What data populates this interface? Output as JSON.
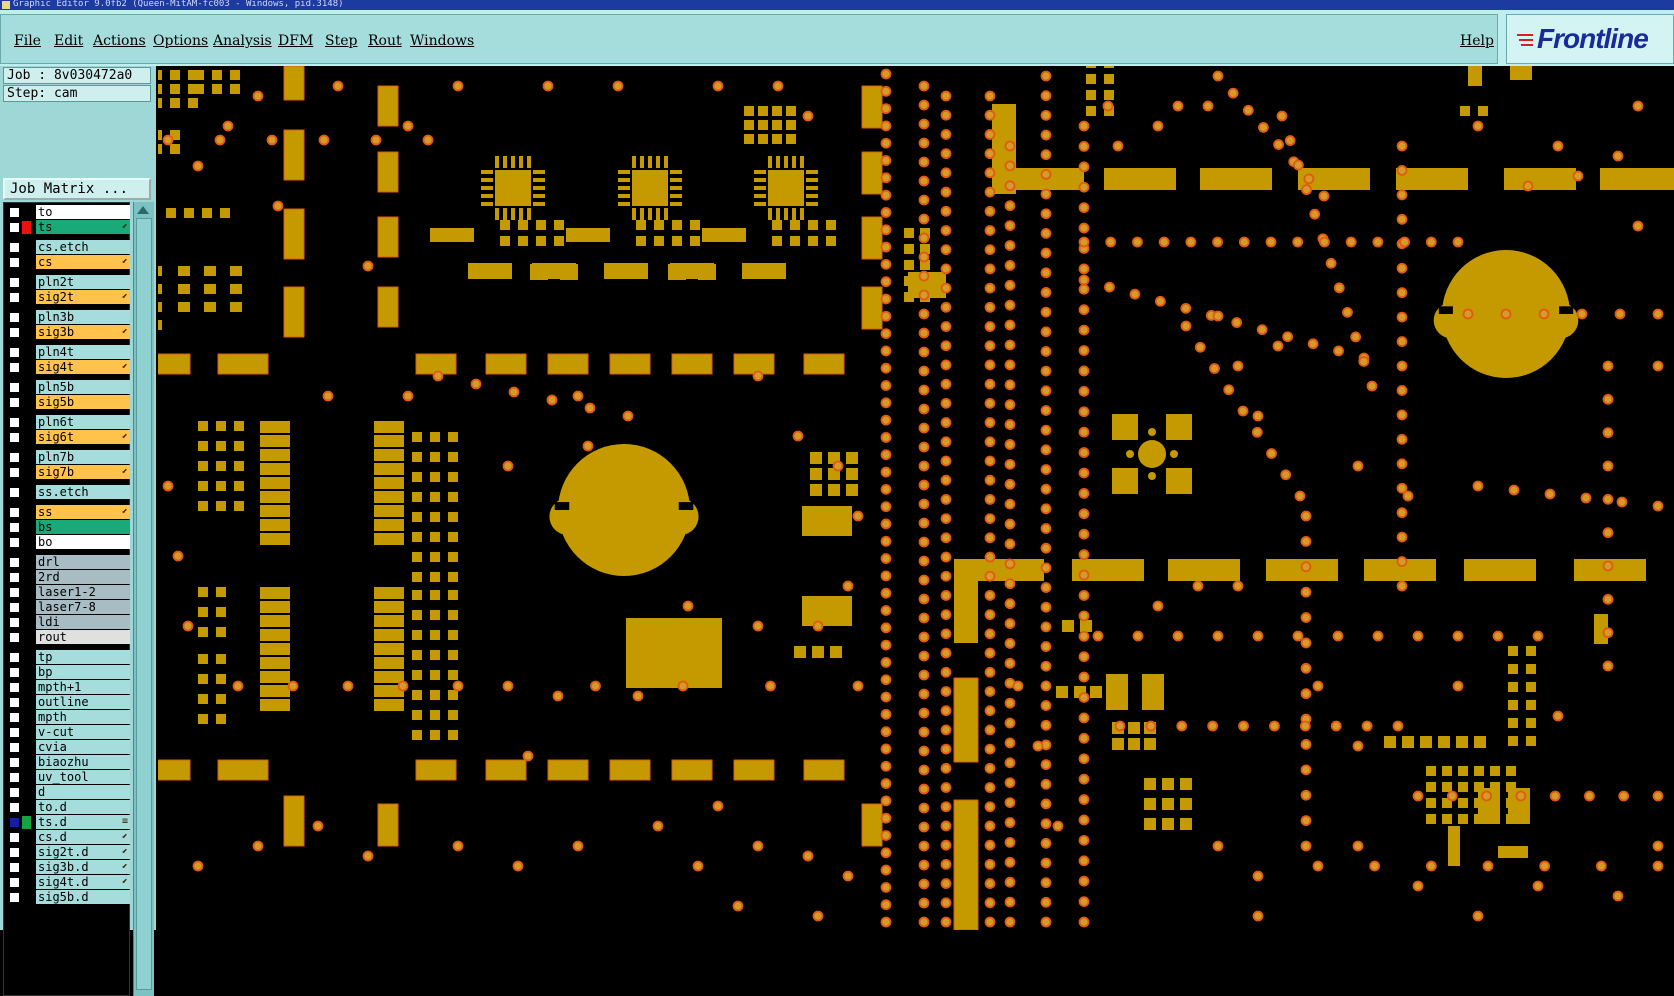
{
  "window": {
    "title": "Graphic Editor 9.0fb2 (Queen-MitAM-fc003 - Windows, pid.3148)"
  },
  "menu": {
    "items": [
      "File",
      "Edit",
      "Actions",
      "Options",
      "Analysis",
      "DFM",
      "Step",
      "Rout",
      "Windows"
    ],
    "help": "Help"
  },
  "logo": {
    "text": "Frontline"
  },
  "job": {
    "job_line": "Job : 8v030472a0",
    "step_line": "Step: cam",
    "matrix_button": "Job Matrix ..."
  },
  "layers": [
    {
      "name": "to",
      "color": "white",
      "flag": "",
      "mark": ""
    },
    {
      "name": "ts",
      "color": "green",
      "flag": "red",
      "mark": "⬋"
    },
    {
      "name": "cs.etch",
      "color": "teal",
      "flag": "",
      "mark": ""
    },
    {
      "name": "cs",
      "color": "orange",
      "flag": "",
      "mark": "⬋"
    },
    {
      "name": "pln2t",
      "color": "teal",
      "flag": "",
      "mark": ""
    },
    {
      "name": "sig2t",
      "color": "orange",
      "flag": "",
      "mark": "⬋"
    },
    {
      "name": "pln3b",
      "color": "teal",
      "flag": "",
      "mark": ""
    },
    {
      "name": "sig3b",
      "color": "orange",
      "flag": "",
      "mark": "⬋"
    },
    {
      "name": "pln4t",
      "color": "teal",
      "flag": "",
      "mark": ""
    },
    {
      "name": "sig4t",
      "color": "orange",
      "flag": "",
      "mark": "⬋"
    },
    {
      "name": "pln5b",
      "color": "teal",
      "flag": "",
      "mark": ""
    },
    {
      "name": "sig5b",
      "color": "orange",
      "flag": "",
      "mark": ""
    },
    {
      "name": "pln6t",
      "color": "teal",
      "flag": "",
      "mark": ""
    },
    {
      "name": "sig6t",
      "color": "orange",
      "flag": "",
      "mark": "⬋"
    },
    {
      "name": "pln7b",
      "color": "teal",
      "flag": "",
      "mark": ""
    },
    {
      "name": "sig7b",
      "color": "orange",
      "flag": "",
      "mark": "⬋"
    },
    {
      "name": "ss.etch",
      "color": "teal",
      "flag": "",
      "mark": ""
    },
    {
      "name": "ss",
      "color": "orange",
      "flag": "",
      "mark": "⬋"
    },
    {
      "name": "bs",
      "color": "green",
      "flag": "",
      "mark": ""
    },
    {
      "name": "bo",
      "color": "white",
      "flag": "",
      "mark": ""
    },
    {
      "name": "drl",
      "color": "gray",
      "flag": "",
      "mark": ""
    },
    {
      "name": "2rd",
      "color": "gray",
      "flag": "",
      "mark": ""
    },
    {
      "name": "laser1-2",
      "color": "gray",
      "flag": "",
      "mark": ""
    },
    {
      "name": "laser7-8",
      "color": "gray",
      "flag": "",
      "mark": ""
    },
    {
      "name": "ldi",
      "color": "gray",
      "flag": "",
      "mark": ""
    },
    {
      "name": "rout",
      "color": "lightgray",
      "flag": "",
      "mark": ""
    },
    {
      "name": "tp",
      "color": "teal",
      "flag": "",
      "mark": ""
    },
    {
      "name": "bp",
      "color": "teal",
      "flag": "",
      "mark": ""
    },
    {
      "name": "mpth+1",
      "color": "teal",
      "flag": "",
      "mark": ""
    },
    {
      "name": "outline",
      "color": "teal",
      "flag": "",
      "mark": ""
    },
    {
      "name": "mpth",
      "color": "teal",
      "flag": "",
      "mark": ""
    },
    {
      "name": "v-cut",
      "color": "teal",
      "flag": "",
      "mark": ""
    },
    {
      "name": "cvia",
      "color": "teal",
      "flag": "",
      "mark": ""
    },
    {
      "name": "biaozhu",
      "color": "teal",
      "flag": "",
      "mark": ""
    },
    {
      "name": "uv_tool",
      "color": "teal",
      "flag": "",
      "mark": ""
    },
    {
      "name": "d",
      "color": "teal",
      "flag": "",
      "mark": ""
    },
    {
      "name": "to.d",
      "color": "teal",
      "flag": "",
      "mark": ""
    },
    {
      "name": "ts.d",
      "color": "teal",
      "flag": "green",
      "mark": "≡",
      "checked": true
    },
    {
      "name": "cs.d",
      "color": "teal",
      "flag": "",
      "mark": "⬋"
    },
    {
      "name": "sig2t.d",
      "color": "teal",
      "flag": "",
      "mark": "⬋"
    },
    {
      "name": "sig3b.d",
      "color": "teal",
      "flag": "",
      "mark": "⬋"
    },
    {
      "name": "sig4t.d",
      "color": "teal",
      "flag": "",
      "mark": "⬋"
    },
    {
      "name": "sig5b.d",
      "color": "teal",
      "flag": "",
      "mark": ""
    }
  ],
  "colors": {
    "copper": "#c49a00",
    "via_ring": "#e05a10",
    "via_core": "#d49a2a",
    "board_bg": "#000000"
  }
}
